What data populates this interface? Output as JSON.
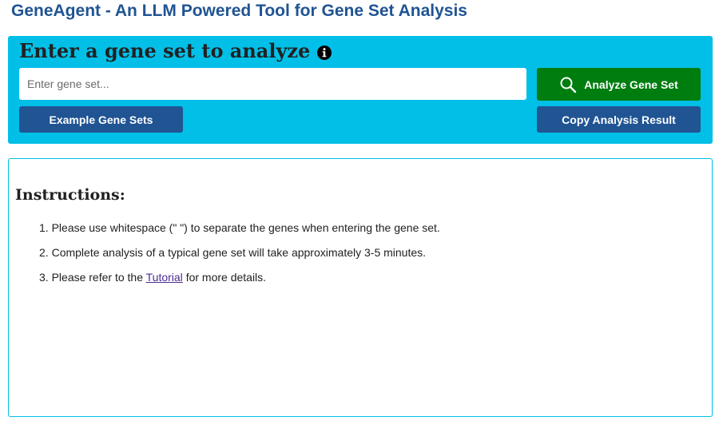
{
  "header": {
    "title": "GeneAgent - An LLM Powered Tool for Gene Set Analysis"
  },
  "input_panel": {
    "heading": "Enter a gene set to analyze",
    "info_icon": "info-circle-icon",
    "gene_input": {
      "value": "",
      "placeholder": "Enter gene set..."
    },
    "analyze_button": {
      "label": "Analyze Gene Set",
      "icon": "search-icon"
    },
    "example_button": {
      "label": "Example Gene Sets"
    },
    "copy_button": {
      "label": "Copy Analysis Result"
    }
  },
  "instructions": {
    "heading": "Instructions:",
    "items": [
      {
        "num": "1.",
        "text": "Please use whitespace (\" \") to separate the genes when entering the gene set."
      },
      {
        "num": "2.",
        "text": "Complete analysis of a typical gene set will take approximately 3-5 minutes."
      },
      {
        "num": "3.",
        "text_before": "Please refer to the",
        "link": "Tutorial",
        "text_after": "for more details."
      }
    ]
  },
  "colors": {
    "title": "#205493",
    "panel_bg": "#02bfe7",
    "analyze_button": "#007d0f",
    "secondary_button": "#205493",
    "result_border": "#02bfe7",
    "link": "#4c2c92"
  }
}
